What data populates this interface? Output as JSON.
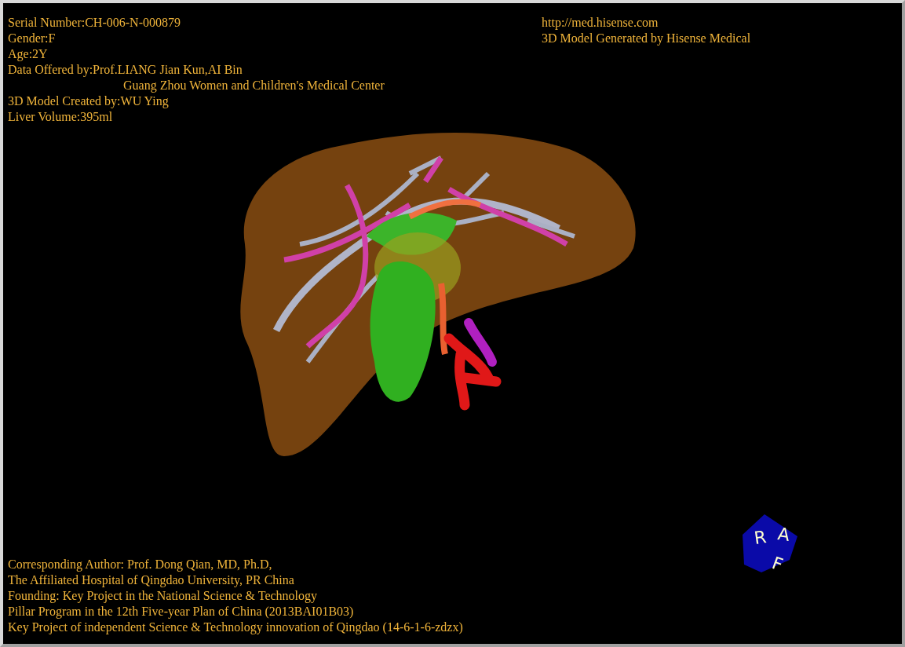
{
  "top_left_info": [
    {
      "lines": [
        "Serial Number:CH-006-N-000879"
      ]
    },
    {
      "lines": [
        "Gender:F"
      ]
    },
    {
      "lines": [
        "Age:2Y"
      ]
    },
    {
      "lines": [
        "Data Offered by:Prof.LIANG Jian Kun,AI Bin",
        "Guang Zhou Women and Children's Medical Center"
      ]
    },
    {
      "lines": [
        "3D Model Created by:WU Ying"
      ]
    },
    {
      "lines": [
        "Liver Volume:395ml"
      ]
    }
  ],
  "top_right_info": [
    "http://med.hisense.com",
    "3D Model Generated by Hisense Medical"
  ],
  "credits": [
    "Corresponding Author: Prof. Dong Qian, MD, Ph.D,",
    "The Affiliated Hospital of Qingdao University, PR China",
    "Founding: Key Project in the National Science & Technology",
    "Pillar Program in the 12th Five-year Plan of China (2013BAI01B03)",
    "Key Project of independent Science & Technology innovation of Qingdao (14-6-1-6-zdzx)"
  ],
  "orientation_cube": {
    "labels": [
      "R",
      "A",
      "F"
    ]
  }
}
